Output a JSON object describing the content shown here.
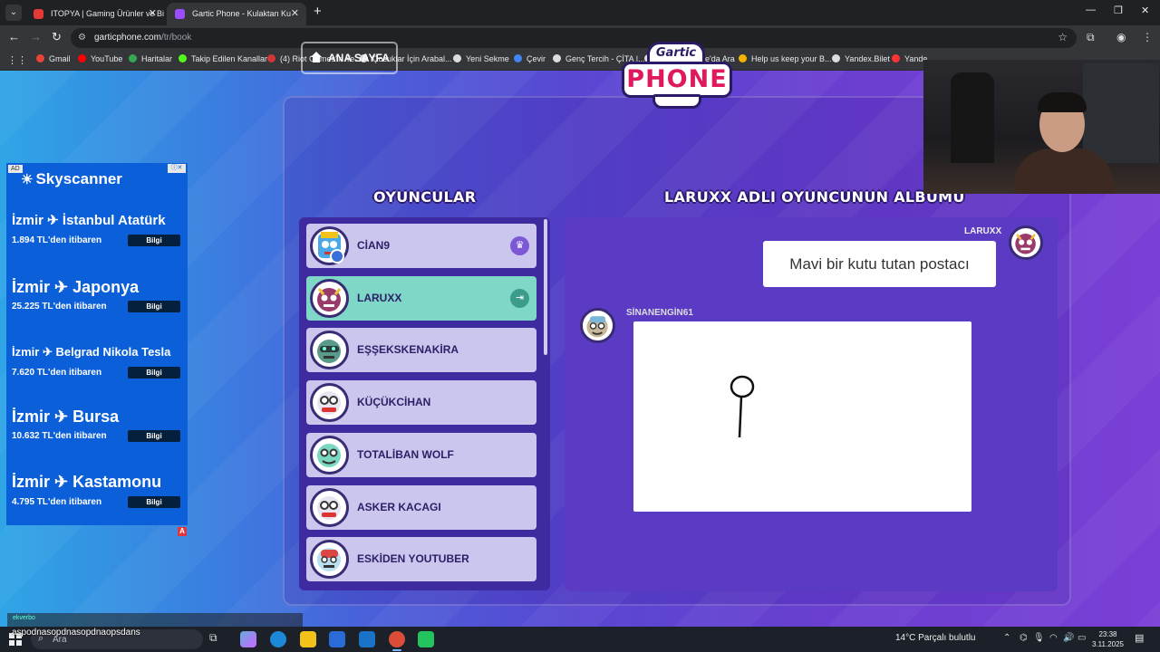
{
  "browser": {
    "tabs": [
      {
        "title": "ITOPYA | Gaming Ürünler ve Bil",
        "close": "✕"
      },
      {
        "title": "Gartic Phone - Kulaktan Ku",
        "close": "✕"
      }
    ],
    "new_tab": "+",
    "url_host": "garticphone.com",
    "url_path": "/tr/book",
    "bookmarks": [
      {
        "label": "Gmail",
        "color": "#ea4335"
      },
      {
        "label": "YouTube",
        "color": "#ff0000"
      },
      {
        "label": "Haritalar",
        "color": "#34a853"
      },
      {
        "label": "Takip Edilen Kanallar",
        "color": "#53fc18"
      },
      {
        "label": "(4) Riot Games'in Ye...",
        "color": "#d13639"
      },
      {
        "label": "Çocuklar İçin Arabal...",
        "color": "#dddddd"
      },
      {
        "label": "Yeni Sekme",
        "color": "#dddddd"
      },
      {
        "label": "Çevir",
        "color": "#4285f4"
      },
      {
        "label": "Genç Tercih - ÇİTA |...",
        "color": "#dddddd"
      },
      {
        "label": "çeviri - Google'da Ara",
        "color": "#dddddd"
      },
      {
        "label": "Help us keep your B...",
        "color": "#f4b400"
      },
      {
        "label": "Yandex.Bilet",
        "color": "#dddddd"
      },
      {
        "label": "Yande...",
        "color": "#ff3333"
      }
    ]
  },
  "game": {
    "home_button": "ANA SAYFA",
    "logo_top": "Gartic",
    "logo_main": "PHONE",
    "players_title": "OYUNCULAR",
    "album_title": "LARUXX ADLI OYUNCUNUN ALBUMU",
    "players": [
      {
        "name": "CİAN9",
        "badge": "♛",
        "active": false,
        "avatar_color": "#4aa8e8"
      },
      {
        "name": "LARUXX",
        "badge": "⇥",
        "active": true,
        "avatar_color": "#9a3a6a"
      },
      {
        "name": "EŞŞEKSKENAKİRA",
        "badge": "",
        "active": false,
        "avatar_color": "#5a9a8a"
      },
      {
        "name": "KÜÇÜKCİHAN",
        "badge": "",
        "active": false,
        "avatar_color": "#e8e4f0"
      },
      {
        "name": "TOTALİBAN WOLF",
        "badge": "",
        "active": false,
        "avatar_color": "#7ad8c0"
      },
      {
        "name": "ASKER KACAGI",
        "badge": "",
        "active": false,
        "avatar_color": "#e8e4f0"
      },
      {
        "name": "ESKİDEN YOUTUBER",
        "badge": "",
        "active": false,
        "avatar_color": "#b8e0f0"
      }
    ],
    "album": {
      "author_name": "LARUXX",
      "prompt_text": "Mavi bir kutu tutan postacı",
      "drawer_name": "SİNANENGİN61"
    }
  },
  "ad": {
    "tag": "AD",
    "close": "ⓘ✕",
    "brand": "Skyscanner",
    "items": [
      {
        "route": "İzmir ✈ İstanbul Atatürk",
        "price": "1.894 TL'den itibaren",
        "button": "Bilgi"
      },
      {
        "route": "İzmir ✈ Japonya",
        "price": "25.225 TL'den itibaren",
        "button": "Bilgi"
      },
      {
        "route": "İzmir ✈ Belgrad Nikola Tesla",
        "price": "7.620 TL'den itibaren",
        "button": "Bilgi"
      },
      {
        "route": "İzmir ✈ Bursa",
        "price": "10.632 TL'den itibaren",
        "button": "Bilgi"
      },
      {
        "route": "İzmir ✈ Kastamonu",
        "price": "4.795 TL'den itibaren",
        "button": "Bilgi"
      }
    ],
    "corner": "A"
  },
  "stream": {
    "chat_user": "ekverbo",
    "chat_message": "aspodnasopdnasopdnaopsdans"
  },
  "taskbar": {
    "search_placeholder": "Ara",
    "weather": "14°C  Parçalı bulutlu",
    "time": "23:38",
    "date": "3.11.2025"
  }
}
